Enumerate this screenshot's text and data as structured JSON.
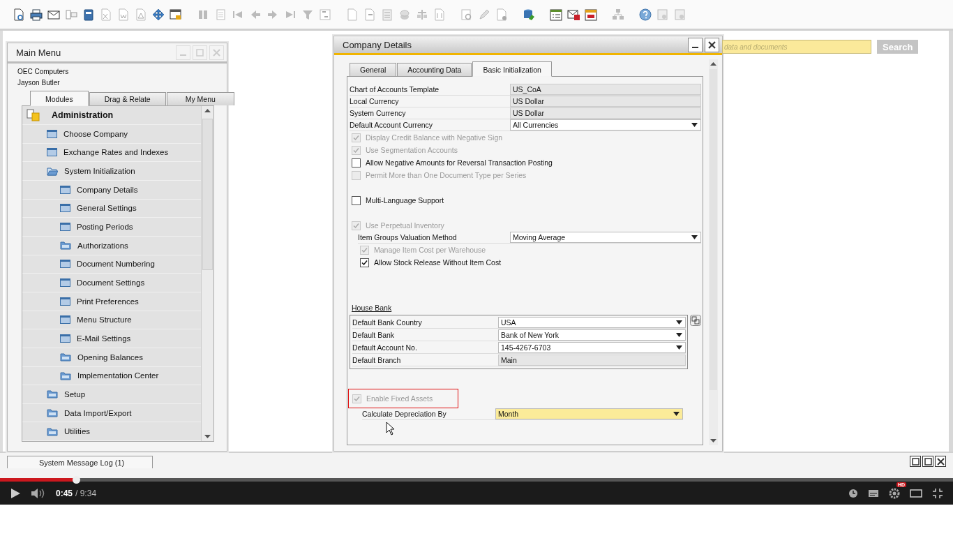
{
  "main_menu": {
    "title": "Main Menu",
    "company": "OEC Computers",
    "user": "Jayson Butler",
    "tabs": [
      {
        "label": "Modules",
        "selected": true
      },
      {
        "label": "Drag & Relate",
        "selected": false
      },
      {
        "label": "My Menu",
        "selected": false
      }
    ],
    "module": {
      "label": "Administration",
      "children": [
        {
          "label": "Choose Company",
          "kind": "form"
        },
        {
          "label": "Exchange Rates and Indexes",
          "kind": "form"
        },
        {
          "label": "System Initialization",
          "kind": "folder",
          "expanded": true,
          "children": [
            {
              "label": "Company Details",
              "kind": "form"
            },
            {
              "label": "General Settings",
              "kind": "form"
            },
            {
              "label": "Posting Periods",
              "kind": "form"
            },
            {
              "label": "Authorizations",
              "kind": "folder",
              "expanded": false
            },
            {
              "label": "Document Numbering",
              "kind": "form"
            },
            {
              "label": "Document Settings",
              "kind": "form"
            },
            {
              "label": "Print Preferences",
              "kind": "form"
            },
            {
              "label": "Menu Structure",
              "kind": "form"
            },
            {
              "label": "E-Mail Settings",
              "kind": "form"
            },
            {
              "label": "Opening Balances",
              "kind": "folder",
              "expanded": false
            },
            {
              "label": "Implementation Center",
              "kind": "folder",
              "expanded": false
            }
          ]
        },
        {
          "label": "Setup",
          "kind": "folder",
          "expanded": false
        },
        {
          "label": "Data Import/Export",
          "kind": "folder",
          "expanded": false
        },
        {
          "label": "Utilities",
          "kind": "folder",
          "expanded": false
        }
      ]
    }
  },
  "company_details": {
    "title": "Company Details",
    "tabs": [
      {
        "label": "General",
        "selected": false
      },
      {
        "label": "Accounting Data",
        "selected": false
      },
      {
        "label": "Basic Initialization",
        "selected": true
      }
    ],
    "sections": [
      {
        "items": [
          {
            "kind": "field",
            "label": "Chart of Accounts Template",
            "value": "US_CoA",
            "dropdown": false
          },
          {
            "kind": "field",
            "label": "Local Currency",
            "value": "US Dollar",
            "dropdown": false
          },
          {
            "kind": "field",
            "label": "System Currency",
            "value": "US Dollar",
            "dropdown": false
          },
          {
            "kind": "field",
            "label": "Default Account Currency",
            "value": "All Currencies",
            "dropdown": true
          },
          {
            "kind": "checkbox",
            "label": "Display Credit Balance with Negative Sign",
            "checked": true,
            "disabled": true
          },
          {
            "kind": "checkbox",
            "label": "Use Segmentation Accounts",
            "checked": true,
            "disabled": true
          },
          {
            "kind": "checkbox",
            "label": "Allow Negative Amounts for Reversal Transaction Posting",
            "checked": false,
            "disabled": false
          },
          {
            "kind": "checkbox",
            "label": "Permit More than One Document Type per Series",
            "checked": false,
            "disabled": true
          }
        ]
      },
      {
        "items": [
          {
            "kind": "checkbox",
            "label": "Multi-Language Support",
            "checked": false,
            "disabled": false
          }
        ]
      },
      {
        "items": [
          {
            "kind": "checkbox",
            "label": "Use Perpetual Inventory",
            "checked": true,
            "disabled": true,
            "children": [
              {
                "kind": "field",
                "label": "Item Groups Valuation Method",
                "value": "Moving Average",
                "dropdown": true
              },
              {
                "kind": "checkbox",
                "label": "Manage Item Cost per Warehouse",
                "checked": true,
                "disabled": true
              },
              {
                "kind": "checkbox",
                "label": "Allow Stock Release Without Item Cost",
                "checked": true,
                "disabled": false
              }
            ]
          }
        ]
      }
    ],
    "house_bank": {
      "title": "House Bank",
      "rows": [
        {
          "label": "Default Bank Country",
          "value": "USA",
          "dropdown": true
        },
        {
          "label": "Default Bank",
          "value": "Bank of New York",
          "dropdown": true
        },
        {
          "label": "Default Account No.",
          "value": "145-4267-6703",
          "dropdown": true
        },
        {
          "label": "Default Branch",
          "value": "Main",
          "dropdown": false
        }
      ]
    },
    "fixed_assets": {
      "label": "Enable Fixed Assets",
      "checked": true,
      "disabled": true,
      "highlighted": true
    },
    "depreciation": {
      "label": "Calculate Depreciation By",
      "value": "Month",
      "dropdown": true
    }
  },
  "search": {
    "placeholder": "data and documents",
    "button": "Search"
  },
  "message_log": {
    "label": "System Message Log (1)"
  },
  "video": {
    "progress": {
      "level": 0.08
    },
    "time": "0:45",
    "duration": "/ 9:34",
    "badge": "HD"
  }
}
